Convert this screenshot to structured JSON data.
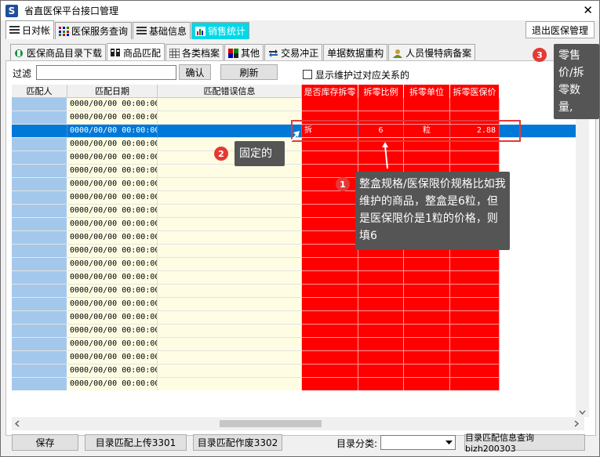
{
  "window": {
    "title": "省直医保平台接口管理",
    "close_glyph": "✕"
  },
  "main_tabs": [
    {
      "label": "日对帐"
    },
    {
      "label": "医保服务查询"
    },
    {
      "label": "基础信息"
    },
    {
      "label": "销售统计"
    }
  ],
  "exit_button": "退出医保管理",
  "sub_tabs": [
    {
      "label": "医保商品目录下载"
    },
    {
      "label": "商品匹配"
    },
    {
      "label": "各类档案"
    },
    {
      "label": "其他"
    },
    {
      "label": "交易冲正"
    },
    {
      "label": "单据数据重构"
    },
    {
      "label": "人员慢特病备案"
    }
  ],
  "filter": {
    "label": "过滤",
    "value": "",
    "confirm": "确认",
    "refresh": "刷新",
    "checkbox_label": "显示维护过对应关系的"
  },
  "grid": {
    "columns": [
      "匹配人",
      "匹配日期",
      "匹配错误信息",
      "是否库存拆零",
      "拆零比例",
      "拆零单位",
      "拆零医保价"
    ],
    "date_placeholder": "0000/00/00 00:00:00",
    "selected_row": {
      "matcher": "",
      "date": "0000/00/00 00:00:00",
      "error": "",
      "split_stock": "拆",
      "split_ratio": "6",
      "split_unit": "粒",
      "split_price": "2.88"
    }
  },
  "bottom": {
    "save": "保存",
    "upload": "目录匹配上传3301",
    "void": "目录匹配作废3302",
    "category_label": "目录分类:",
    "category_value": "",
    "query": "目录匹配信息查询bizh200303"
  },
  "annotations": {
    "a1": {
      "number": "1",
      "text": "整盒规格/医保限价规格比如我维护的商品，整盒是6粒，但是医保限价是1粒的价格，则填6"
    },
    "a2": {
      "number": "2",
      "text": "固定的"
    },
    "a3": {
      "number": "3",
      "text": "零售价/拆零数量,"
    }
  },
  "colors": {
    "red": "#ff0000",
    "selected": "#0078d7",
    "matcher_cell": "#a4c8ec",
    "date_cell": "#fefde4",
    "callout": "#555555",
    "badge": "#e53935",
    "cyan_tab": "#00d8e8"
  }
}
